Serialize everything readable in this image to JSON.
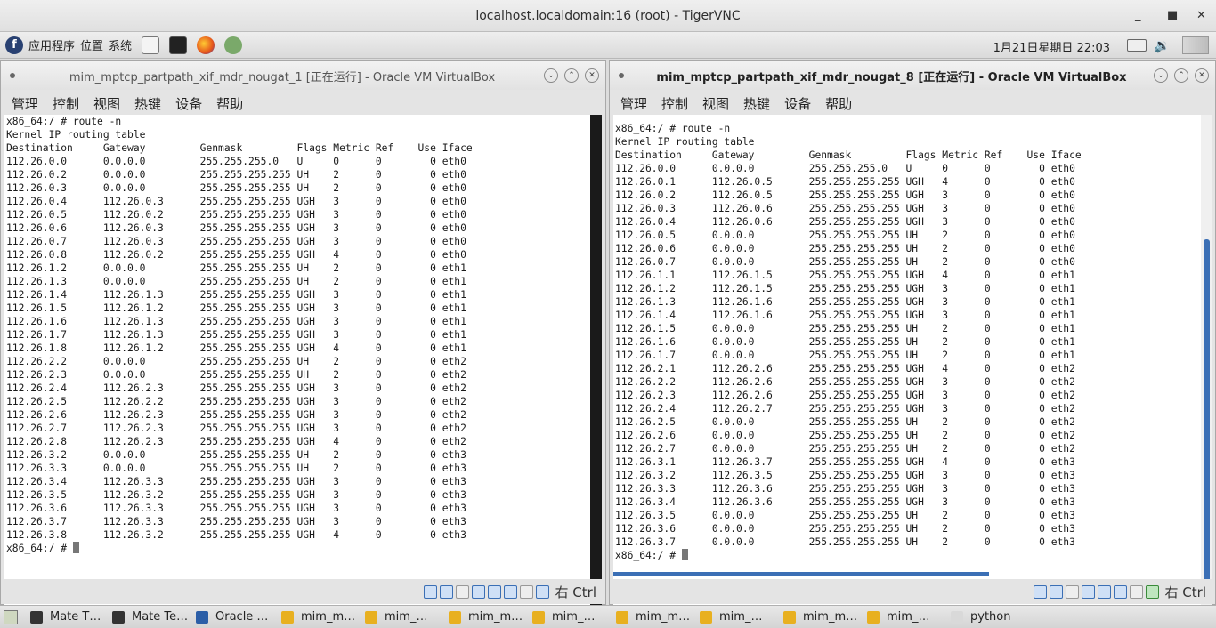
{
  "window": {
    "title": "localhost.localdomain:16 (root) - TigerVNC"
  },
  "panel": {
    "apps": "应用程序",
    "places": "位置",
    "system": "系统",
    "clock": "1月21日星期日 22:03"
  },
  "vm1": {
    "title": "mim_mptcp_partpath_xif_mdr_nougat_1 [正在运行] - Oracle VM VirtualBox",
    "menu": [
      "管理",
      "控制",
      "视图",
      "热键",
      "设备",
      "帮助"
    ],
    "status_ctrl": "右 Ctrl",
    "lines": [
      "x86_64:/ # route -n",
      "Kernel IP routing table",
      "Destination     Gateway         Genmask         Flags Metric Ref    Use Iface",
      "112.26.0.0      0.0.0.0         255.255.255.0   U     0      0        0 eth0",
      "112.26.0.2      0.0.0.0         255.255.255.255 UH    2      0        0 eth0",
      "112.26.0.3      0.0.0.0         255.255.255.255 UH    2      0        0 eth0",
      "112.26.0.4      112.26.0.3      255.255.255.255 UGH   3      0        0 eth0",
      "112.26.0.5      112.26.0.2      255.255.255.255 UGH   3      0        0 eth0",
      "112.26.0.6      112.26.0.3      255.255.255.255 UGH   3      0        0 eth0",
      "112.26.0.7      112.26.0.3      255.255.255.255 UGH   3      0        0 eth0",
      "112.26.0.8      112.26.0.2      255.255.255.255 UGH   4      0        0 eth0",
      "112.26.1.2      0.0.0.0         255.255.255.255 UH    2      0        0 eth1",
      "112.26.1.3      0.0.0.0         255.255.255.255 UH    2      0        0 eth1",
      "112.26.1.4      112.26.1.3      255.255.255.255 UGH   3      0        0 eth1",
      "112.26.1.5      112.26.1.2      255.255.255.255 UGH   3      0        0 eth1",
      "112.26.1.6      112.26.1.3      255.255.255.255 UGH   3      0        0 eth1",
      "112.26.1.7      112.26.1.3      255.255.255.255 UGH   3      0        0 eth1",
      "112.26.1.8      112.26.1.2      255.255.255.255 UGH   4      0        0 eth1",
      "112.26.2.2      0.0.0.0         255.255.255.255 UH    2      0        0 eth2",
      "112.26.2.3      0.0.0.0         255.255.255.255 UH    2      0        0 eth2",
      "112.26.2.4      112.26.2.3      255.255.255.255 UGH   3      0        0 eth2",
      "112.26.2.5      112.26.2.2      255.255.255.255 UGH   3      0        0 eth2",
      "112.26.2.6      112.26.2.3      255.255.255.255 UGH   3      0        0 eth2",
      "112.26.2.7      112.26.2.3      255.255.255.255 UGH   3      0        0 eth2",
      "112.26.2.8      112.26.2.3      255.255.255.255 UGH   4      0        0 eth2",
      "112.26.3.2      0.0.0.0         255.255.255.255 UH    2      0        0 eth3",
      "112.26.3.3      0.0.0.0         255.255.255.255 UH    2      0        0 eth3",
      "112.26.3.4      112.26.3.3      255.255.255.255 UGH   3      0        0 eth3",
      "112.26.3.5      112.26.3.2      255.255.255.255 UGH   3      0        0 eth3",
      "112.26.3.6      112.26.3.3      255.255.255.255 UGH   3      0        0 eth3",
      "112.26.3.7      112.26.3.3      255.255.255.255 UGH   3      0        0 eth3",
      "112.26.3.8      112.26.3.2      255.255.255.255 UGH   4      0        0 eth3"
    ],
    "prompt": "x86_64:/ # "
  },
  "vm8": {
    "title": "mim_mptcp_partpath_xif_mdr_nougat_8 [正在运行] - Oracle VM VirtualBox",
    "menu": [
      "管理",
      "控制",
      "视图",
      "热键",
      "设备",
      "帮助"
    ],
    "status_ctrl": "右 Ctrl",
    "lines": [
      "x86_64:/ # route -n",
      "Kernel IP routing table",
      "Destination     Gateway         Genmask         Flags Metric Ref    Use Iface",
      "112.26.0.0      0.0.0.0         255.255.255.0   U     0      0        0 eth0",
      "112.26.0.1      112.26.0.5      255.255.255.255 UGH   4      0        0 eth0",
      "112.26.0.2      112.26.0.5      255.255.255.255 UGH   3      0        0 eth0",
      "112.26.0.3      112.26.0.6      255.255.255.255 UGH   3      0        0 eth0",
      "112.26.0.4      112.26.0.6      255.255.255.255 UGH   3      0        0 eth0",
      "112.26.0.5      0.0.0.0         255.255.255.255 UH    2      0        0 eth0",
      "112.26.0.6      0.0.0.0         255.255.255.255 UH    2      0        0 eth0",
      "112.26.0.7      0.0.0.0         255.255.255.255 UH    2      0        0 eth0",
      "112.26.1.1      112.26.1.5      255.255.255.255 UGH   4      0        0 eth1",
      "112.26.1.2      112.26.1.5      255.255.255.255 UGH   3      0        0 eth1",
      "112.26.1.3      112.26.1.6      255.255.255.255 UGH   3      0        0 eth1",
      "112.26.1.4      112.26.1.6      255.255.255.255 UGH   3      0        0 eth1",
      "112.26.1.5      0.0.0.0         255.255.255.255 UH    2      0        0 eth1",
      "112.26.1.6      0.0.0.0         255.255.255.255 UH    2      0        0 eth1",
      "112.26.1.7      0.0.0.0         255.255.255.255 UH    2      0        0 eth1",
      "112.26.2.1      112.26.2.6      255.255.255.255 UGH   4      0        0 eth2",
      "112.26.2.2      112.26.2.6      255.255.255.255 UGH   3      0        0 eth2",
      "112.26.2.3      112.26.2.6      255.255.255.255 UGH   3      0        0 eth2",
      "112.26.2.4      112.26.2.7      255.255.255.255 UGH   3      0        0 eth2",
      "112.26.2.5      0.0.0.0         255.255.255.255 UH    2      0        0 eth2",
      "112.26.2.6      0.0.0.0         255.255.255.255 UH    2      0        0 eth2",
      "112.26.2.7      0.0.0.0         255.255.255.255 UH    2      0        0 eth2",
      "112.26.3.1      112.26.3.7      255.255.255.255 UGH   4      0        0 eth3",
      "112.26.3.2      112.26.3.5      255.255.255.255 UGH   3      0        0 eth3",
      "112.26.3.3      112.26.3.6      255.255.255.255 UGH   3      0        0 eth3",
      "112.26.3.4      112.26.3.6      255.255.255.255 UGH   3      0        0 eth3",
      "112.26.3.5      0.0.0.0         255.255.255.255 UH    2      0        0 eth3",
      "112.26.3.6      0.0.0.0         255.255.255.255 UH    2      0        0 eth3",
      "112.26.3.7      0.0.0.0         255.255.255.255 UH    2      0        0 eth3"
    ],
    "prompt": "x86_64:/ # "
  },
  "taskbar": [
    {
      "label": "Mate T…",
      "icon": "terminal-icon"
    },
    {
      "label": "Mate Te…",
      "icon": "terminal-icon"
    },
    {
      "label": "Oracle …",
      "icon": "virtualbox-icon"
    },
    {
      "label": "mim_m…",
      "icon": "vm-icon"
    },
    {
      "label": "mim_…",
      "icon": "vm-icon"
    },
    {
      "label": "mim_m…",
      "icon": "vm-icon"
    },
    {
      "label": "mim_…",
      "icon": "vm-icon"
    },
    {
      "label": "mim_m…",
      "icon": "vm-icon"
    },
    {
      "label": "mim_…",
      "icon": "vm-icon"
    },
    {
      "label": "mim_m…",
      "icon": "vm-icon"
    },
    {
      "label": "mim_…",
      "icon": "vm-icon"
    },
    {
      "label": "python",
      "icon": "folder-icon"
    }
  ],
  "colors": {
    "accent": "#3b6fb5",
    "terminal_bg": "#ffffff",
    "scrollbar": "#1a1a1a",
    "vm_icon": "#e8b020"
  }
}
